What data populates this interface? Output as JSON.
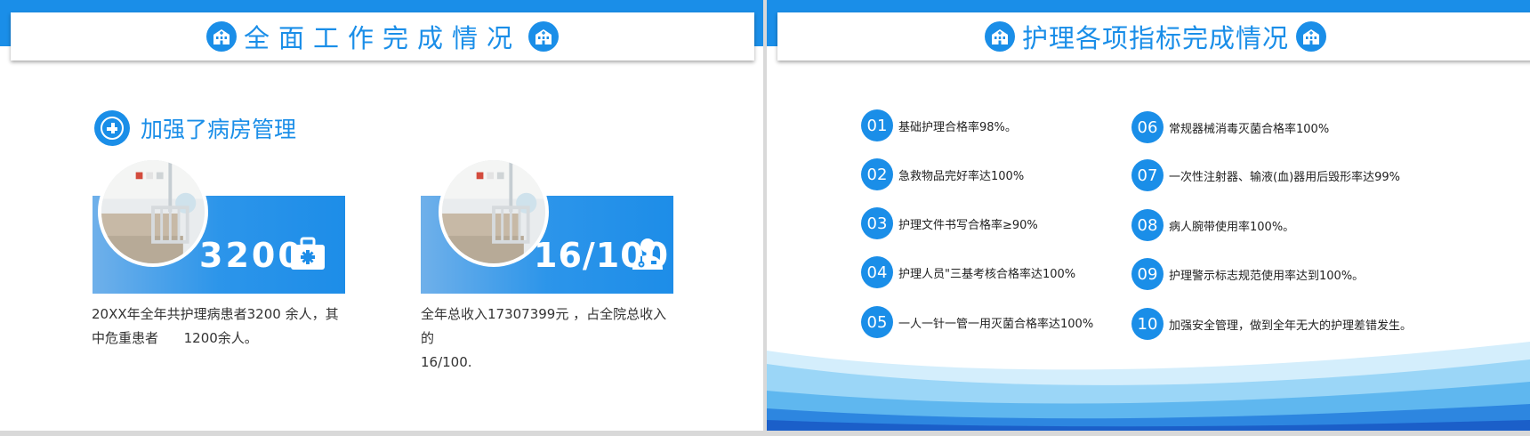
{
  "left_slide": {
    "title": "全面工作完成情况",
    "section_title": "加强了病房管理",
    "stats": [
      {
        "value": "3200",
        "icon": "medical-kit-icon",
        "description_line1": "20XX年全年共护理病患者3200 余人，其",
        "description_line2": "中危重患者      1200余人。"
      },
      {
        "value": "16/100",
        "icon": "doctor-icon",
        "description_line1": "全年总收入17307399元 ，占全院总收入的",
        "description_line2": "16/100."
      }
    ]
  },
  "right_slide": {
    "title": "护理各项指标完成情况",
    "items": [
      {
        "num": "01",
        "text": "基础护理合格率98%。"
      },
      {
        "num": "02",
        "text": "急救物品完好率达100%"
      },
      {
        "num": "03",
        "text": "护理文件书写合格率≥90%"
      },
      {
        "num": "04",
        "text": "护理人员\"三基考核合格率达100%"
      },
      {
        "num": "05",
        "text": "一人一针一管一用灭菌合格率达100%"
      },
      {
        "num": "06",
        "text": "常规器械消毒灭菌合格率100%"
      },
      {
        "num": "07",
        "text": "一次性注射器、输液(血)器用后毁形率达99%"
      },
      {
        "num": "08",
        "text": "病人腕带使用率100%。"
      },
      {
        "num": "09",
        "text": "护理警示标志规范使用率达到100%。"
      },
      {
        "num": "10",
        "text": "加强安全管理，做到全年无大的护理差错发生。"
      }
    ]
  },
  "colors": {
    "accent": "#1a8ee8",
    "text": "#333333",
    "background": "#ffffff"
  }
}
